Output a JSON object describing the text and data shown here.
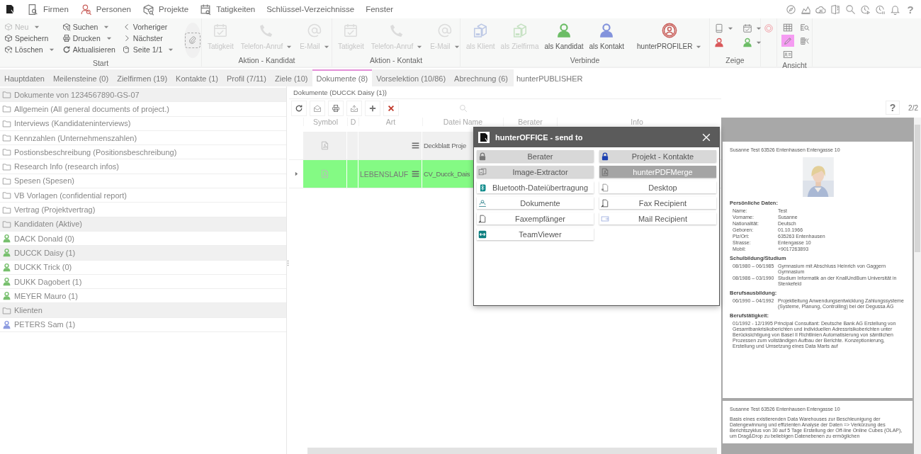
{
  "menubar": {
    "items": [
      {
        "label": "Firmen"
      },
      {
        "label": "Personen"
      },
      {
        "label": "Projekte"
      },
      {
        "label": "Tatigkeiten"
      },
      {
        "label": "Schlüssel-Verzeichnisse"
      },
      {
        "label": "Fenster"
      }
    ],
    "help": "?"
  },
  "ribbon": {
    "groups": [
      {
        "kind": "start",
        "label": "Start",
        "columns": [
          [
            {
              "label": "Neu",
              "disabled": true,
              "dropdown": true
            },
            {
              "label": "Speichern",
              "disabled": false,
              "dropdown": false
            },
            {
              "label": "Löschen",
              "disabled": false,
              "dropdown": true
            }
          ],
          [
            {
              "label": "Suchen",
              "disabled": false,
              "dropdown": true
            },
            {
              "label": "Drucken",
              "disabled": false,
              "dropdown": true
            },
            {
              "label": "Aktualisieren",
              "disabled": false,
              "dropdown": false
            }
          ],
          [
            {
              "label": "Vorheriger",
              "disabled": false,
              "dropdown": false
            },
            {
              "label": "Nächster",
              "disabled": false,
              "dropdown": false
            },
            {
              "label": "Seite 1/1",
              "disabled": false,
              "dropdown": true
            }
          ]
        ]
      },
      {
        "kind": "actions",
        "label": "Aktion - Kandidat",
        "buttons": [
          {
            "label": "Tatigkeit",
            "disabled": true,
            "dropdown": false
          },
          {
            "label": "Telefon-Anruf",
            "disabled": true,
            "dropdown": true
          },
          {
            "label": "E-Mail",
            "disabled": true,
            "dropdown": true
          }
        ]
      },
      {
        "kind": "actions",
        "label": "Aktion - Kontakt",
        "buttons": [
          {
            "label": "Tatigkeit",
            "disabled": true,
            "dropdown": false
          },
          {
            "label": "Telefon-Anruf",
            "disabled": true,
            "dropdown": true
          },
          {
            "label": "E-Mail",
            "disabled": true,
            "dropdown": true
          }
        ]
      },
      {
        "kind": "connect",
        "label": "Verbinde",
        "buttons": [
          {
            "label": "als Klient",
            "disabled": true,
            "dropdown": false
          },
          {
            "label": "als Zielfirma",
            "disabled": true,
            "dropdown": false
          },
          {
            "label": "als Kandidat",
            "disabled": false,
            "dropdown": false
          },
          {
            "label": "als Kontakt",
            "disabled": false,
            "dropdown": false
          },
          {
            "label": "hunterPROFILER",
            "disabled": false,
            "dropdown": true
          }
        ]
      },
      {
        "kind": "show",
        "label": "Zeige",
        "items": [
          {
            "dropdown": true
          },
          {
            "dropdown": true
          },
          {
            "dropdown": false
          },
          {
            "dropdown": true
          }
        ]
      },
      {
        "kind": "extra"
      },
      {
        "kind": "view",
        "label": "Ansicht",
        "items": [
          {
            "selected": false
          },
          {
            "selected": false
          },
          {
            "selected": true
          },
          {
            "selected": false
          },
          {
            "selected": false
          }
        ]
      }
    ]
  },
  "tabs": [
    {
      "label": "Hauptdaten",
      "selected": false
    },
    {
      "label": "Meilensteine (0)",
      "selected": false
    },
    {
      "label": "Zielfirmen (19)",
      "selected": false
    },
    {
      "label": "Kontakte (1)",
      "selected": false
    },
    {
      "label": "Profil (7/11)",
      "selected": false
    },
    {
      "label": "Ziele (10)",
      "selected": false
    },
    {
      "label": "Dokumente (8)",
      "selected": true
    },
    {
      "label": "Vorselektion (10/86)",
      "selected": false
    },
    {
      "label": "Abrechnung (6)",
      "selected": false
    },
    {
      "label": "hunterPUBLISHER",
      "selected": false
    }
  ],
  "tree": {
    "sections": [
      {
        "label": "Dokumente von 1234567890-GS-07",
        "items": [
          {
            "kind": "folder",
            "label": "Allgemein (All general documents of project.)",
            "selected": false
          },
          {
            "kind": "folder",
            "label": "Interviews (Kandidateninterviews)",
            "selected": false
          },
          {
            "kind": "folder",
            "label": "Kennzahlen (Unternehmenszahlen)",
            "selected": false
          },
          {
            "kind": "folder",
            "label": "Postionsbeschreibung (Positionsbeschreibung)",
            "selected": false
          },
          {
            "kind": "folder",
            "label": "Research Info (research infos)",
            "selected": false
          },
          {
            "kind": "folder",
            "label": "Spesen (Spesen)",
            "selected": false
          },
          {
            "kind": "folder",
            "label": "VB Vorlagen (confidential report)",
            "selected": false
          },
          {
            "kind": "folder",
            "label": "Vertrag (Projektvertrag)",
            "selected": false
          }
        ]
      },
      {
        "label": "Kandidaten (Aktive)",
        "items": [
          {
            "kind": "person",
            "label": "DACK Donald (0)",
            "color": "#78c06e",
            "selected": false
          },
          {
            "kind": "person",
            "label": "DUCCK Daisy (1)",
            "color": "#78c06e",
            "selected": true
          },
          {
            "kind": "person",
            "label": "DUCKK Trick (0)",
            "color": "#78c06e",
            "selected": false
          },
          {
            "kind": "person",
            "label": "DUKK Dagobert (1)",
            "color": "#78c06e",
            "selected": false
          },
          {
            "kind": "person",
            "label": "MEYER Mauro (1)",
            "color": "#78c06e",
            "selected": false
          }
        ]
      },
      {
        "label": "Klienten",
        "items": [
          {
            "kind": "person",
            "label": "PETERS Sam (1)",
            "color": "#8c9be0",
            "selected": false
          }
        ]
      }
    ]
  },
  "documents": {
    "title": "Dokumente (DUCCK Daisy (1))",
    "columns": [
      "Symbol",
      "D",
      "Art",
      "Datei Name",
      "Berater",
      "Info"
    ],
    "rows": [
      {
        "file": "Deckblatt Proje",
        "selected": false
      },
      {
        "art": "LEBENSLAUF",
        "file": "CV_Ducck_Dais",
        "selected": true
      }
    ]
  },
  "preview": {
    "help": "?",
    "page_count": "2/2",
    "pages": [
      {
        "header": "Susanne Test 63526 Entenhausen Entengasse 10",
        "photo": {
          "kind": "picture"
        },
        "sections": [
          {
            "heading": "Persönliche Daten:",
            "rows": [
              [
                "Name:",
                "Test"
              ],
              [
                "Vorname:",
                "Susanne"
              ],
              [
                "Nationalität:",
                "Deutsch"
              ],
              [
                "Geboren:",
                "01.10.1966"
              ],
              [
                "Plz/Ort:",
                "635263 Entenhausen"
              ],
              [
                "Strasse:",
                "Entengasse 10"
              ],
              [
                "Mobil:",
                "+9017263893"
              ]
            ]
          },
          {
            "heading": "Schulbildung/Studium",
            "rows": [
              [
                "08/1980 – 06/1985",
                "Gymnasium mit Abschluss      Heinrich von Gaggern Gymnasium"
              ],
              [
                "08/1986 – 03/1990",
                "Studium Informatik an der KnallUndBum Universität in Stenkefeld"
              ]
            ]
          },
          {
            "heading": "Berufsausbildung:",
            "rows": [
              [
                "06/1990 – 04/1992",
                "Projektleitung Anwendungsentwicklung Zahlungssysteme (Systeme, Planung, Controlling) bei der Degussa AG"
              ]
            ]
          },
          {
            "heading": "Berufstätigkeit:",
            "paragraph": "01/1992 - 12/1995  Principal Consultant: Deutsche Bank AG Erstellung von Gesamtbankrisikoberichten und individuellen Adressrisikoberichten unter Berücksichtigung von Basel II Richtlinien Automatisierung von sämtlichen Prozessen zum vollständigen Aufbau der Berichte. Konzeptionierung, Erstellung und Umsetzung eines Data Marts auf"
          }
        ]
      },
      {
        "header": "Susanne Test 63526 Entenhausen Entengasse 10",
        "paragraph": "Basis eines existierenden Data Warehouses zur Beschleunigung der Datengewinnung und effizienten Analyse der Daten => Verkürzung des Berichtszyklus von 30 auf 5 Tage Erstellung der Off-line Online Cubes (OLAP), um Drag&Drop zu beliebigen Datenebenen zu ermöglichen"
      }
    ]
  },
  "dialog": {
    "title": "hunterOFFICE - send to",
    "targets": [
      {
        "label": "Berater",
        "shaded": true,
        "disabled": false
      },
      {
        "label": "Projekt - Kontakte",
        "shaded": true,
        "disabled": false
      },
      {
        "label": "Image-Extractor",
        "shaded": true,
        "disabled": false
      },
      {
        "label": "hunterPDFMerge",
        "shaded": true,
        "disabled": true
      },
      {
        "label": "Bluetooth-Dateiübertragung",
        "shaded": false,
        "disabled": false
      },
      {
        "label": "Desktop",
        "shaded": false,
        "disabled": false
      },
      {
        "label": "Dokumente",
        "shaded": false,
        "disabled": false
      },
      {
        "label": "Fax Recipient",
        "shaded": false,
        "disabled": false
      },
      {
        "label": "Faxempfänger",
        "shaded": false,
        "disabled": false
      },
      {
        "label": "Mail Recipient",
        "shaded": false,
        "disabled": false
      },
      {
        "label": "TeamViewer",
        "shaded": false,
        "disabled": false
      }
    ]
  }
}
